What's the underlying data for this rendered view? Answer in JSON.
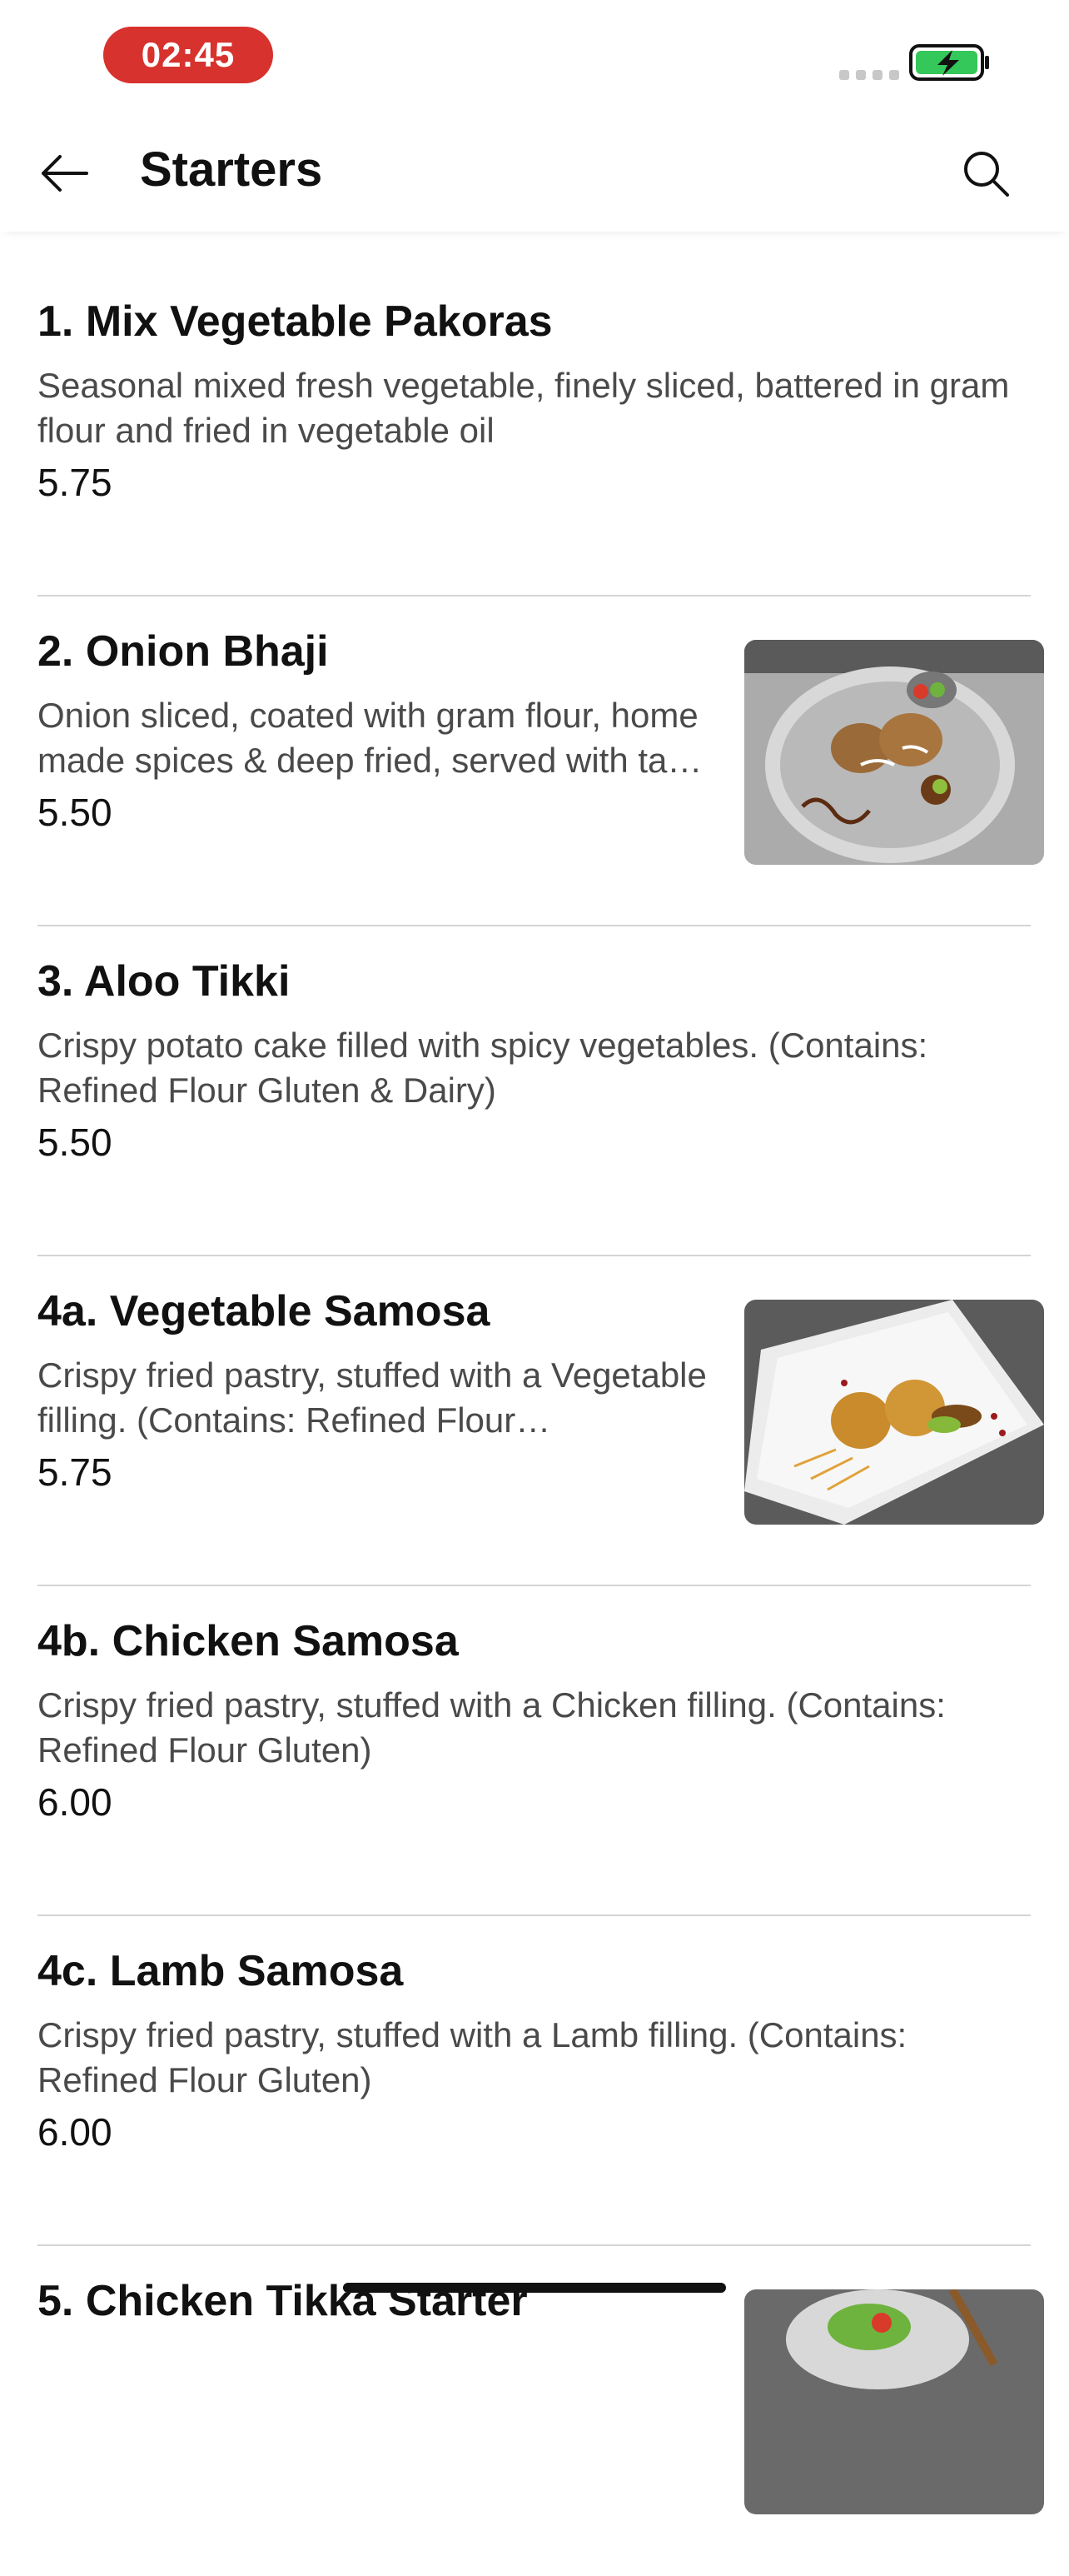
{
  "status_bar": {
    "time": "02:45",
    "battery_color": "#34c759",
    "time_pill_color": "#d7322e"
  },
  "header": {
    "title": "Starters"
  },
  "items": [
    {
      "name": "1. Mix Vegetable Pakoras",
      "description": "Seasonal mixed fresh vegetable, finely sliced, battered in gram flour and fried in vegetable oil",
      "price": "5.75",
      "has_image": false
    },
    {
      "name": "2. Onion Bhaji",
      "description": "Onion sliced, coated with gram flour, home made spices & deep fried, served with ta…",
      "price": "5.50",
      "has_image": true
    },
    {
      "name": "3. Aloo Tikki",
      "description": "Crispy potato cake filled with spicy vegetables. (Contains: Refined Flour Gluten & Dairy)",
      "price": "5.50",
      "has_image": false
    },
    {
      "name": "4a. Vegetable Samosa",
      "description": "Crispy fried pastry, stuffed with a Vegetable filling. (Contains: Refined Flour…",
      "price": "5.75",
      "has_image": true
    },
    {
      "name": "4b. Chicken Samosa",
      "description": "Crispy fried pastry, stuffed with a Chicken filling. (Contains: Refined Flour Gluten)",
      "price": "6.00",
      "has_image": false
    },
    {
      "name": "4c. Lamb Samosa",
      "description": "Crispy fried pastry, stuffed with a Lamb filling. (Contains: Refined Flour Gluten)",
      "price": "6.00",
      "has_image": false
    },
    {
      "name": "5. Chicken Tikka Starter",
      "description": "",
      "price": "",
      "has_image": true
    }
  ]
}
